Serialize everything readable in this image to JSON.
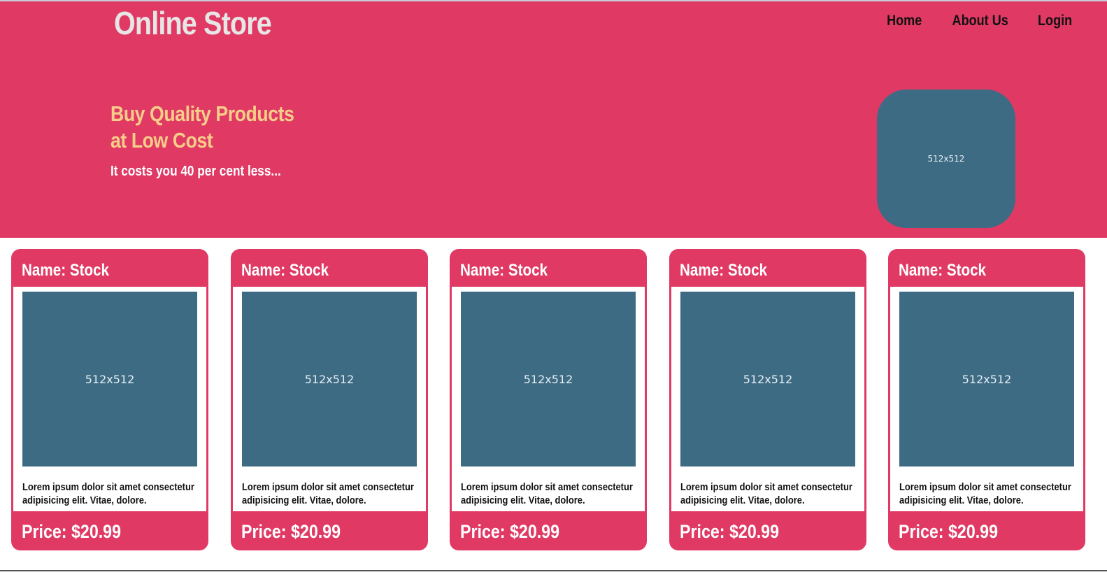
{
  "header": {
    "logo": "Online Store",
    "nav": [
      "Home",
      "About Us",
      "Login"
    ]
  },
  "hero": {
    "headline_line1": "Buy Quality Products",
    "headline_line2": "at Low Cost",
    "subline": "It costs you 40 per cent less...",
    "image_label": "512x512"
  },
  "products": [
    {
      "name": "Name: Stock",
      "image_label": "512x512",
      "description": "Lorem ipsum dolor sit amet consectetur adipisicing elit. Vitae, dolore.",
      "price": "Price: $20.99"
    },
    {
      "name": "Name: Stock",
      "image_label": "512x512",
      "description": "Lorem ipsum dolor sit amet consectetur adipisicing elit. Vitae, dolore.",
      "price": "Price: $20.99"
    },
    {
      "name": "Name: Stock",
      "image_label": "512x512",
      "description": "Lorem ipsum dolor sit amet consectetur adipisicing elit. Vitae, dolore.",
      "price": "Price: $20.99"
    },
    {
      "name": "Name: Stock",
      "image_label": "512x512",
      "description": "Lorem ipsum dolor sit amet consectetur adipisicing elit. Vitae, dolore.",
      "price": "Price: $20.99"
    },
    {
      "name": "Name: Stock",
      "image_label": "512x512",
      "description": "Lorem ipsum dolor sit amet consectetur adipisicing elit. Vitae, dolore.",
      "price": "Price: $20.99"
    }
  ],
  "colors": {
    "brand": "#e03a64",
    "headline": "#f6cd89",
    "placeholder": "#3d6b84",
    "logo": "#e6e6e6"
  }
}
